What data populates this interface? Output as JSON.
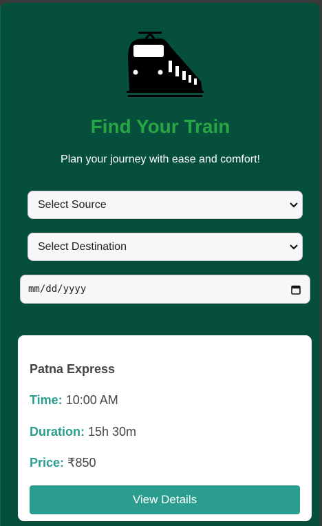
{
  "header": {
    "icon": "train-icon",
    "title": "Find Your Train",
    "subtitle": "Plan your journey with ease and comfort!"
  },
  "form": {
    "source": {
      "selected": "Select Source",
      "icon": "chevron-down-icon"
    },
    "destination": {
      "selected": "Select Destination",
      "icon": "chevron-down-icon"
    },
    "date": {
      "placeholder": "mm/dd/yyyy",
      "icon": "calendar-icon"
    }
  },
  "result": {
    "train_name": "Patna Express",
    "time_label": "Time:",
    "time_value": "10:00 AM",
    "duration_label": "Duration:",
    "duration_value": "15h 30m",
    "price_label": "Price:",
    "price_value": "₹850",
    "button_label": "View Details"
  },
  "colors": {
    "background": "#064f3d",
    "title": "#27a641",
    "accent": "#2a9d8f"
  }
}
